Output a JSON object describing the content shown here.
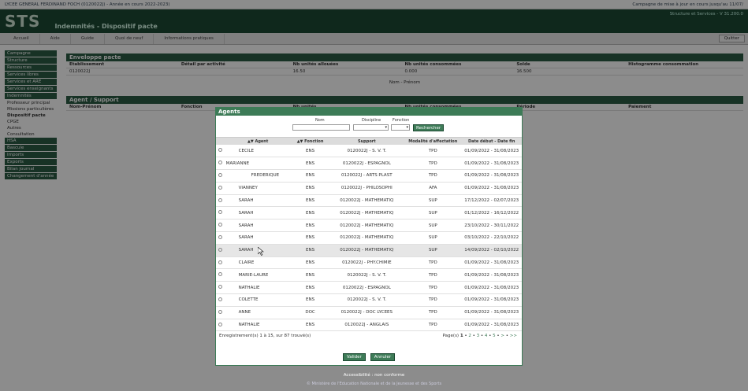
{
  "topbar": {
    "left": "LYCEE GENERAL FERDINAND FOCH (0120022J) - Année en cours 2022-2023)",
    "right": "Campagne de mise à jour en cours jusqu'au 11/07/"
  },
  "header": {
    "logo": "STS",
    "title": "Indemnités - Dispositif pacte",
    "subtitle": "Structure et Services - V 31.200.0"
  },
  "nav": [
    "Accueil",
    "Aide",
    "Guide",
    "Quoi de neuf",
    "Informations pratiques"
  ],
  "nav_quit": "Quitter",
  "left": [
    {
      "t": "m",
      "l": "Campagne"
    },
    {
      "t": "m",
      "l": "Structure"
    },
    {
      "t": "m",
      "l": "Ressources"
    },
    {
      "t": "m",
      "l": "Services libres"
    },
    {
      "t": "m",
      "l": "Services et ARE"
    },
    {
      "t": "m",
      "l": "Services enseignants"
    },
    {
      "t": "m",
      "l": "Indemnités"
    },
    {
      "t": "s",
      "l": "Professeur principal"
    },
    {
      "t": "s",
      "l": "Missions particulières"
    },
    {
      "t": "s",
      "l": "Dispositif pacte",
      "b": true
    },
    {
      "t": "s",
      "l": "CPGE"
    },
    {
      "t": "s",
      "l": "Autres"
    },
    {
      "t": "s",
      "l": "Consultation"
    },
    {
      "t": "m",
      "l": "HSA"
    },
    {
      "t": "m",
      "l": "Bascule"
    },
    {
      "t": "m",
      "l": "Imports"
    },
    {
      "t": "m",
      "l": "Exports"
    },
    {
      "t": "m",
      "l": "Bilan journal"
    },
    {
      "t": "m",
      "l": "Changement d'année"
    }
  ],
  "envelope": {
    "title": "Enveloppe pacte",
    "headers": [
      "Etablissement",
      "Détail par activité",
      "Nb unités allouées",
      "Nb unités consommées",
      "Solde",
      "Histogramme consommation"
    ],
    "row": [
      "0120022J",
      "",
      "16.50",
      "0.000",
      "16.500",
      ""
    ]
  },
  "search_label": "Nom - Prénom",
  "agent_panel": {
    "title": "Agent / Support",
    "headers": [
      "Nom-Prénom",
      "Fonction",
      "Nb unités",
      "Nb unités consommées",
      "Période",
      "Paiement"
    ]
  },
  "modal": {
    "title": "Agents",
    "filter_nom": "Nom",
    "filter_discipline": "Discipline",
    "filter_fonction": "Fonction",
    "search_btn": "Rechercher",
    "headers": [
      "Agent",
      "Fonction",
      "Support",
      "Modalité d'affectation",
      "Date début - Date fin"
    ],
    "rows": [
      [
        "CECILE",
        "ENS",
        "0120022J - S. V. T.",
        "TPD",
        "01/09/2022 - 31/08/2023"
      ],
      [
        "MARIANNE",
        "ENS",
        "0120022J - ESPAGNOL",
        "TPD",
        "01/09/2022 - 31/08/2023"
      ],
      [
        "FREDERIQUE",
        "ENS",
        "0120022J - ARTS PLAST",
        "TPD",
        "01/09/2022 - 31/08/2023"
      ],
      [
        "VIANNEY",
        "ENS",
        "0120022J - PHILOSOPHI",
        "AFA",
        "01/09/2022 - 31/08/2023"
      ],
      [
        "SARAH",
        "ENS",
        "0120022J - MATHEMATIQ",
        "SUP",
        "17/12/2022 - 02/07/2023"
      ],
      [
        "SARAH",
        "ENS",
        "0120022J - MATHEMATIQ",
        "SUP",
        "01/12/2022 - 16/12/2022"
      ],
      [
        "SARAH",
        "ENS",
        "0120022J - MATHEMATIQ",
        "SUP",
        "23/10/2022 - 30/11/2022"
      ],
      [
        "SARAH",
        "ENS",
        "0120022J - MATHEMATIQ",
        "SUP",
        "03/10/2022 - 22/10/2022"
      ],
      [
        "SARAH",
        "ENS",
        "0120022J - MATHEMATIQ",
        "SUP",
        "14/09/2022 - 02/10/2022"
      ],
      [
        "CLAIRE",
        "ENS",
        "0120022J - PHY.CHIMIE",
        "TPD",
        "01/09/2022 - 31/08/2023"
      ],
      [
        "MARIE-LAURE",
        "ENS",
        "0120022J - S. V. T.",
        "TPD",
        "01/09/2022 - 31/08/2023"
      ],
      [
        "NATHALIE",
        "ENS",
        "0120022J - ESPAGNOL",
        "TPD",
        "01/09/2022 - 31/08/2023"
      ],
      [
        "COLETTE",
        "ENS",
        "0120022J - S. V. T.",
        "TPD",
        "01/09/2022 - 31/08/2023"
      ],
      [
        "ANNE",
        "DOC",
        "0120022J - DOC LYCEES",
        "TPD",
        "01/09/2022 - 31/08/2023"
      ],
      [
        "NATHALIE",
        "ENS",
        "0120022J - ANGLAIS",
        "TPD",
        "01/09/2022 - 31/08/2023"
      ]
    ],
    "record_count": "Enregistrement(s) 1 à 15, sur 87 trouvé(s)",
    "pager_prefix": "Page(s)",
    "pager_current": "1",
    "pages": [
      "2",
      "3",
      "4",
      "5",
      ">",
      ">>"
    ],
    "validate": "Valider",
    "cancel": "Annuler"
  },
  "footer": "Accessibilité : non conforme",
  "footer2": "© Ministère de l'Education Nationale et de la Jeunesse et des Sports"
}
